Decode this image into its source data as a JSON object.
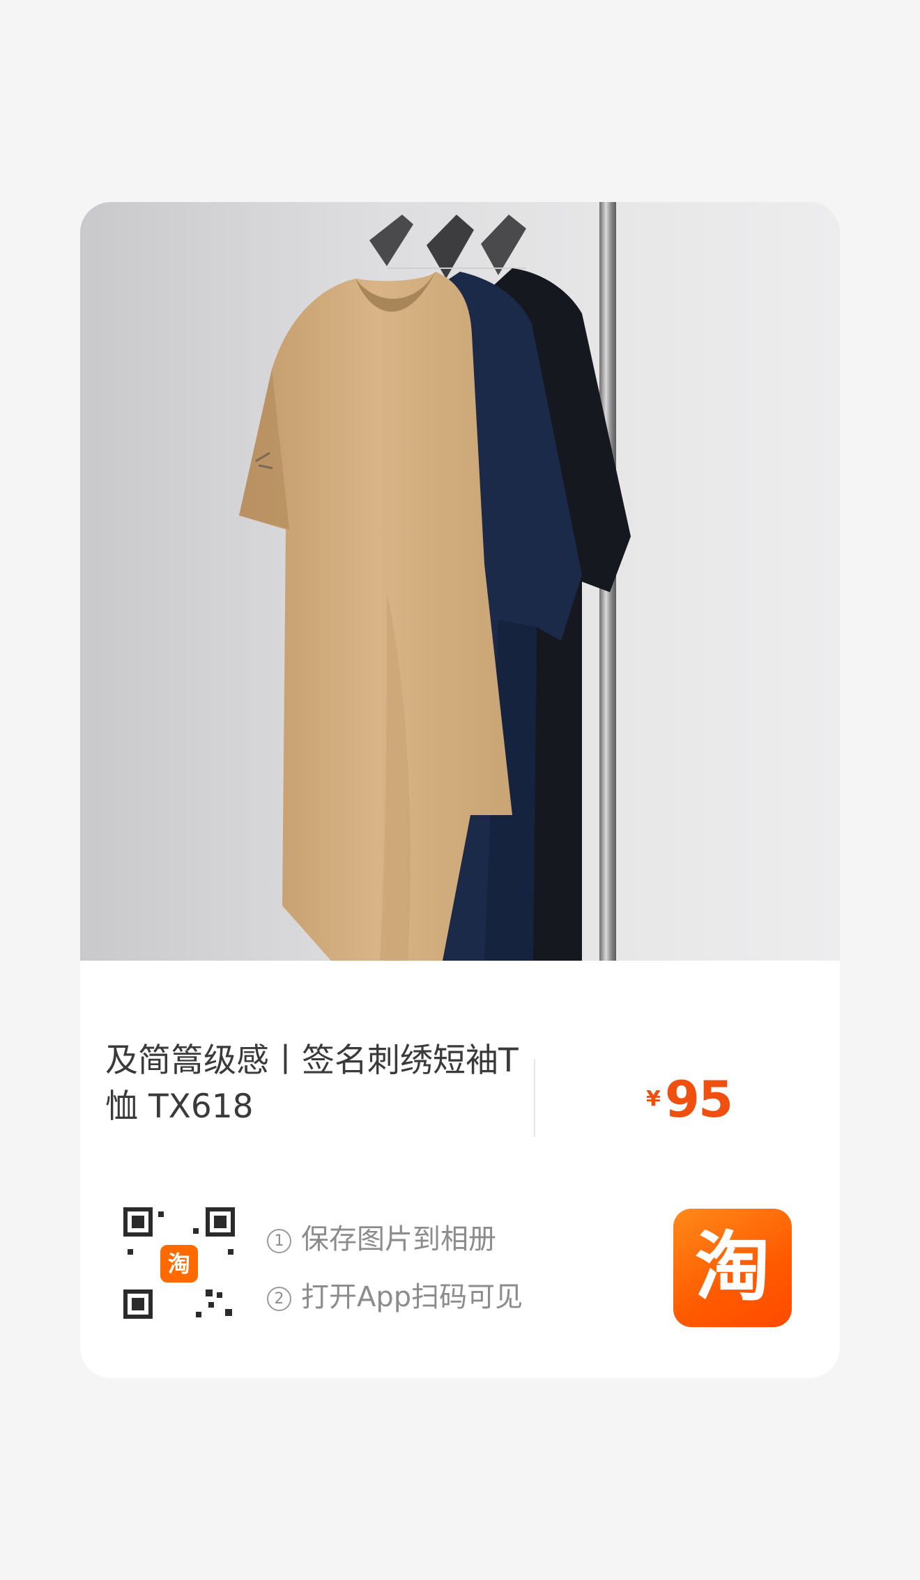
{
  "product": {
    "title": "及简篙级感丨签名刺绣短袖T恤 TX618",
    "currency_symbol": "¥",
    "price": "95"
  },
  "qr": {
    "badge_label": "淘"
  },
  "steps": [
    {
      "number": "1",
      "text": "保存图片到相册"
    },
    {
      "number": "2",
      "text": "打开App扫码可见"
    }
  ],
  "app_icon": {
    "label": "淘",
    "icon": "taobao-app-icon"
  },
  "colors": {
    "price": "#f0500f",
    "brand": "#ff5a00",
    "background": "#f5f5f5",
    "card": "#ffffff"
  }
}
